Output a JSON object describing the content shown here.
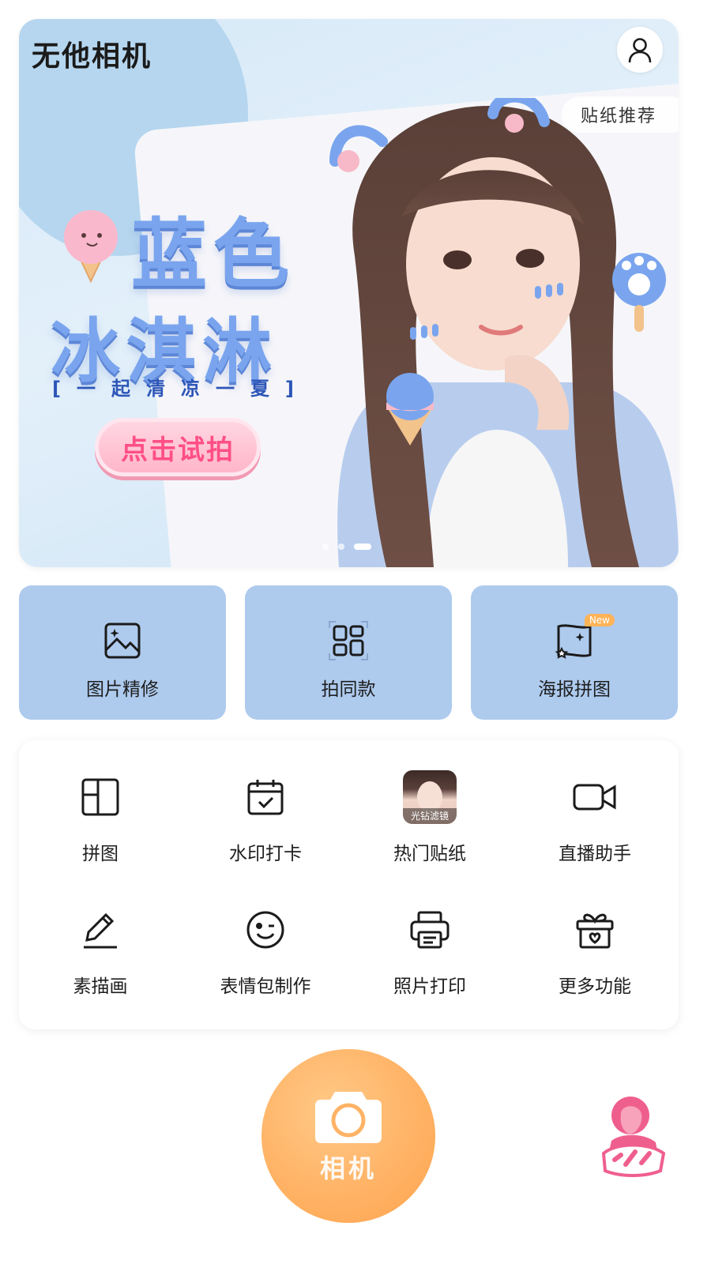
{
  "app": {
    "brand": "无他相机"
  },
  "banner": {
    "chip": "贴纸推荐",
    "headline_line1": "蓝色",
    "headline_line2": "冰淇淋",
    "tagline": "[一起清凉一夏]",
    "cta": "点击试拍",
    "carousel_total": 3,
    "carousel_active": 3
  },
  "features": [
    {
      "label": "图片精修",
      "icon": "image-icon"
    },
    {
      "label": "拍同款",
      "icon": "grid-scan-icon"
    },
    {
      "label": "海报拼图",
      "icon": "poster-icon",
      "badge": "New"
    }
  ],
  "tools": [
    {
      "label": "拼图",
      "icon": "collage-icon"
    },
    {
      "label": "水印打卡",
      "icon": "calendar-check-icon"
    },
    {
      "label": "热门贴纸",
      "icon": "thumbnail",
      "thumb_caption": "光钻滤镜"
    },
    {
      "label": "直播助手",
      "icon": "video-camera-icon"
    },
    {
      "label": "素描画",
      "icon": "pencil-icon"
    },
    {
      "label": "表情包制作",
      "icon": "wink-face-icon"
    },
    {
      "label": "照片打印",
      "icon": "printer-icon"
    },
    {
      "label": "更多功能",
      "icon": "gift-icon"
    }
  ],
  "camera": {
    "label": "相机"
  },
  "colors": {
    "feature_bg": "#aecbee",
    "camera_orange": "#ffb366",
    "headline_blue": "#7aa5ee",
    "cta_pink": "#ff4f86"
  }
}
